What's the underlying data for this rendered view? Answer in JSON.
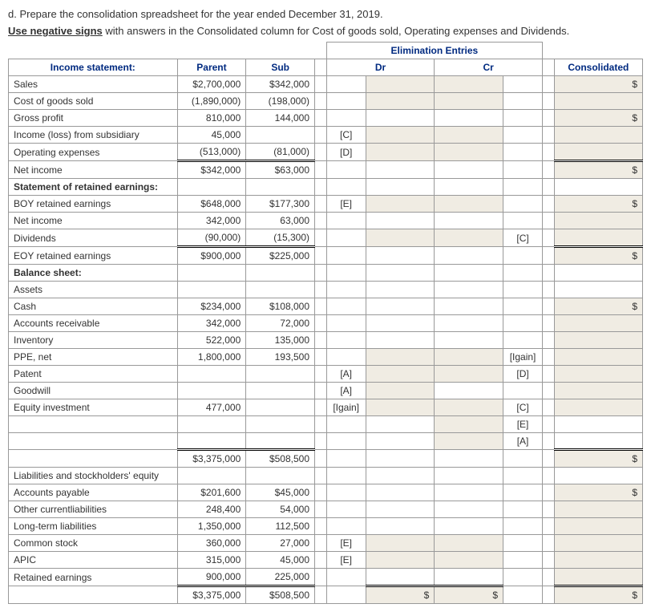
{
  "prompt_d": "d. Prepare the consolidation spreadsheet for the year ended December 31, 2019.",
  "prompt_note_pre": "Use negative signs",
  "prompt_note_post": " with answers in the Consolidated column for Cost of goods sold, Operating expenses and Dividends.",
  "hdr": {
    "income": "Income statement:",
    "parent": "Parent",
    "sub": "Sub",
    "elim": "Elimination Entries",
    "dr": "Dr",
    "cr": "Cr",
    "cons": "Consolidated"
  },
  "rows": {
    "sales": {
      "label": "Sales",
      "parent": "$2,700,000",
      "sub": "$342,000",
      "cons": "$"
    },
    "cogs": {
      "label": "Cost of goods sold",
      "parent": "(1,890,000)",
      "sub": "(198,000)"
    },
    "gross": {
      "label": "Gross profit",
      "parent": "810,000",
      "sub": "144,000",
      "cons": "$"
    },
    "incsub": {
      "label": "Income (loss) from subsidiary",
      "parent": "45,000",
      "drTag": "[C]"
    },
    "opex": {
      "label": "Operating expenses",
      "parent": "(513,000)",
      "sub": "(81,000)",
      "drTag": "[D]"
    },
    "ni": {
      "label": "Net income",
      "parent": "$342,000",
      "sub": "$63,000",
      "cons": "$"
    },
    "sre": {
      "label": "Statement of retained earnings:"
    },
    "boy": {
      "label": "BOY retained earnings",
      "parent": "$648,000",
      "sub": "$177,300",
      "drTag": "[E]",
      "cons": "$"
    },
    "ni2": {
      "label": "Net income",
      "parent": "342,000",
      "sub": "63,000"
    },
    "div": {
      "label": "Dividends",
      "parent": "(90,000)",
      "sub": "(15,300)",
      "crTag": "[C]"
    },
    "eoy": {
      "label": "EOY retained earnings",
      "parent": "$900,000",
      "sub": "$225,000",
      "cons": "$"
    },
    "bs": {
      "label": "Balance sheet:"
    },
    "assets": {
      "label": "Assets"
    },
    "cash": {
      "label": "Cash",
      "parent": "$234,000",
      "sub": "$108,000",
      "cons": "$"
    },
    "ar": {
      "label": "Accounts receivable",
      "parent": "342,000",
      "sub": "72,000"
    },
    "inv": {
      "label": "Inventory",
      "parent": "522,000",
      "sub": "135,000"
    },
    "ppe": {
      "label": "PPE, net",
      "parent": "1,800,000",
      "sub": "193,500",
      "crTag": "[Igain]"
    },
    "patent": {
      "label": "Patent",
      "drTag": "[A]",
      "crTag": "[D]"
    },
    "gw": {
      "label": "Goodwill",
      "drTag": "[A]"
    },
    "eqinv": {
      "label": "Equity investment",
      "parent": "477,000",
      "drTag": "[Igain]",
      "crTag": "[C]"
    },
    "blank1": {
      "crTag": "[E]"
    },
    "blank2": {
      "crTag": "[A]"
    },
    "tot1": {
      "parent": "$3,375,000",
      "sub": "$508,500",
      "cons": "$"
    },
    "liab": {
      "label": "Liabilities and stockholders' equity"
    },
    "ap": {
      "label": "Accounts payable",
      "parent": "$201,600",
      "sub": "$45,000",
      "cons": "$"
    },
    "ocl": {
      "label": "Other currentliabilities",
      "parent": "248,400",
      "sub": "54,000"
    },
    "ltl": {
      "label": "Long-term liabilities",
      "parent": "1,350,000",
      "sub": "112,500"
    },
    "cs": {
      "label": "Common stock",
      "parent": "360,000",
      "sub": "27,000",
      "drTag": "[E]"
    },
    "apic": {
      "label": "APIC",
      "parent": "315,000",
      "sub": "45,000",
      "drTag": "[E]"
    },
    "re": {
      "label": "Retained earnings",
      "parent": "900,000",
      "sub": "225,000"
    },
    "tot2": {
      "parent": "$3,375,000",
      "sub": "$508,500",
      "drTot": "$",
      "crTot": "$",
      "cons": "$"
    }
  }
}
